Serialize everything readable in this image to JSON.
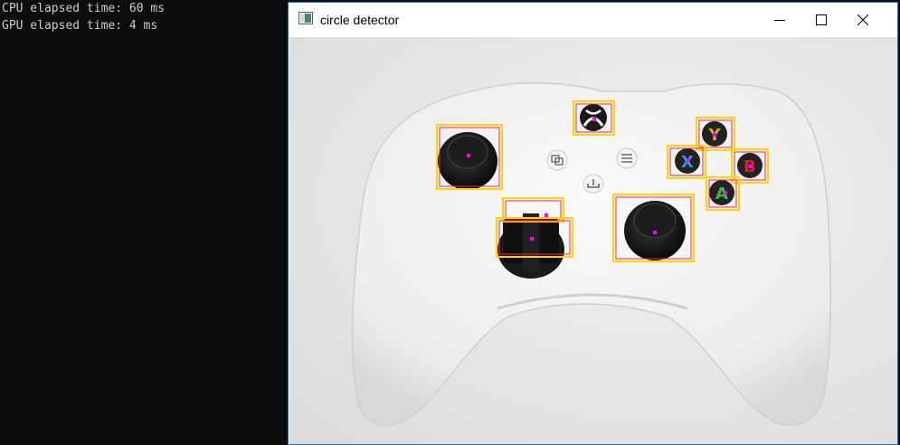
{
  "console": {
    "lines": [
      "CPU elapsed time: 60 ms",
      "GPU elapsed time: 4 ms"
    ]
  },
  "window": {
    "title": "circle detector",
    "accent_color": "#1a73d0"
  },
  "detection": {
    "box_color": "#ffd400",
    "inner_box_color": "#ff2050",
    "center_color": "#ff00ff",
    "button_letters": [
      "Y",
      "X",
      "B",
      "A"
    ]
  }
}
